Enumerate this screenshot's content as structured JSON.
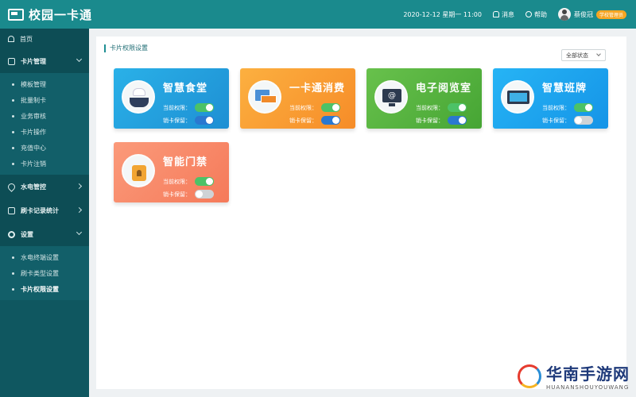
{
  "app": {
    "title": "校园一卡通"
  },
  "header": {
    "datetime": "2020-12-12  星期一  11:00",
    "messages": "消息",
    "help": "帮助",
    "user": "蔡俊冠",
    "badge": "学校管理员"
  },
  "sidebar": {
    "home": "首页",
    "card_mgmt": "卡片管理",
    "card_items": [
      "模板管理",
      "批量制卡",
      "业务审核",
      "卡片操作",
      "充值中心",
      "卡片注销"
    ],
    "utility": "水电管控",
    "swipe_stats": "刷卡记录统计",
    "settings": "设置",
    "settings_items": [
      "水电终端设置",
      "刷卡类型设置",
      "卡片权限设置"
    ]
  },
  "main": {
    "title": "卡片权限设置",
    "status_select": "全部状态",
    "labels": {
      "current": "当前权限：",
      "revoke": "销卡保留："
    },
    "cards": [
      {
        "name": "智慧食堂",
        "current": true,
        "revoke": true
      },
      {
        "name": "一卡通消费",
        "current": true,
        "revoke": true
      },
      {
        "name": "电子阅览室",
        "current": true,
        "revoke": true
      },
      {
        "name": "智慧班牌",
        "current": true,
        "revoke": false
      },
      {
        "name": "智能门禁",
        "current": true,
        "revoke": false
      }
    ]
  },
  "watermark": {
    "cn": "华南手游网",
    "en": "HUANANSHOUYOUWANG"
  },
  "colors": {
    "header": "#1a8a8d",
    "sidebar": "#0f5760",
    "toggle_on": "#4cc267",
    "toggle_blue": "#2a78d0"
  }
}
